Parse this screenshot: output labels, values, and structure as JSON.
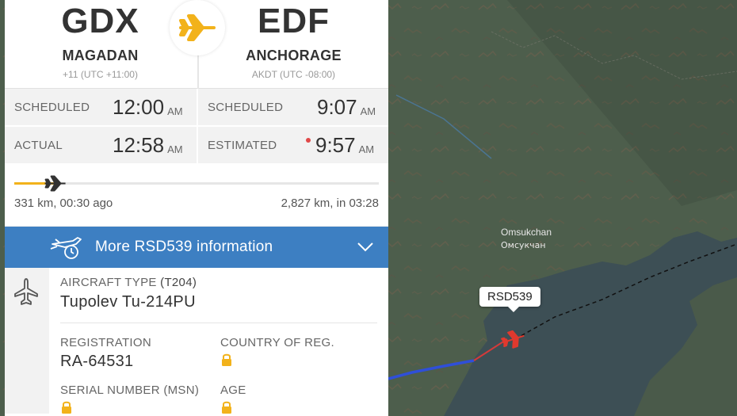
{
  "route": {
    "origin": {
      "code": "GDX",
      "city": "MAGADAN",
      "timezone": "+11 (UTC +11:00)"
    },
    "destination": {
      "code": "EDF",
      "city": "ANCHORAGE",
      "timezone": "AKDT (UTC -08:00)"
    }
  },
  "times": {
    "departure": {
      "scheduled_label": "SCHEDULED",
      "scheduled_time": "12:00",
      "scheduled_ampm": "AM",
      "actual_label": "ACTUAL",
      "actual_time": "12:58",
      "actual_ampm": "AM"
    },
    "arrival": {
      "scheduled_label": "SCHEDULED",
      "scheduled_time": "9:07",
      "scheduled_ampm": "AM",
      "estimated_label": "ESTIMATED",
      "estimated_time": "9:57",
      "estimated_ampm": "AM"
    }
  },
  "progress": {
    "fraction": 0.11,
    "elapsed_text": "331 km, 00:30 ago",
    "remaining_text": "2,827 km, in 03:28"
  },
  "more_info": {
    "label": "More RSD539 information"
  },
  "aircraft": {
    "type_label": "AIRCRAFT TYPE",
    "type_code": "(T204)",
    "type_name": "Tupolev Tu-214PU",
    "registration_label": "REGISTRATION",
    "registration": "RA-64531",
    "country_label": "COUNTRY OF REG.",
    "serial_label": "SERIAL NUMBER (MSN)",
    "age_label": "AGE"
  },
  "map": {
    "place_label_latin": "Omsukchan",
    "place_label_cyrillic": "Омсукчан",
    "callsign": "RSD539"
  },
  "colors": {
    "accent_blue": "#3d7fc2",
    "progress_yellow": "#f2b21b",
    "plane_red": "#e0392e",
    "lock_yellow": "#f2b21b"
  },
  "icons": {
    "route_plane": "plane-icon",
    "progress_plane": "plane-icon",
    "more_info": "plane-clock-icon",
    "chevron": "chevron-down-icon",
    "aircraft": "aircraft-icon",
    "lock": "lock-icon"
  }
}
